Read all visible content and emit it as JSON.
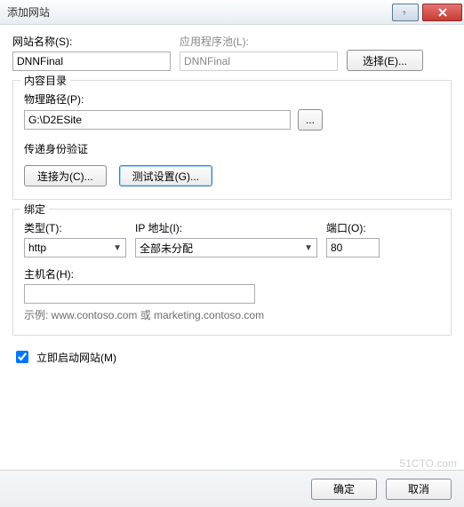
{
  "window": {
    "title": "添加网站"
  },
  "site": {
    "name_label": "网站名称(S):",
    "name_value": "DNNFinal",
    "apppool_label": "应用程序池(L):",
    "apppool_value": "DNNFinal",
    "select_btn": "选择(E)..."
  },
  "content": {
    "legend": "内容目录",
    "path_label": "物理路径(P):",
    "path_value": "G:\\D2ESite",
    "browse_btn": "...",
    "auth_label": "传递身份验证",
    "connect_btn": "连接为(C)...",
    "test_btn": "测试设置(G)..."
  },
  "binding": {
    "legend": "绑定",
    "type_label": "类型(T):",
    "type_value": "http",
    "ip_label": "IP 地址(I):",
    "ip_value": "全部未分配",
    "port_label": "端口(O):",
    "port_value": "80",
    "host_label": "主机名(H):",
    "host_value": "",
    "hint": "示例: www.contoso.com 或 marketing.contoso.com"
  },
  "start_now_label": "立即启动网站(M)",
  "start_now_checked": true,
  "footer": {
    "ok": "确定",
    "cancel": "取消"
  }
}
